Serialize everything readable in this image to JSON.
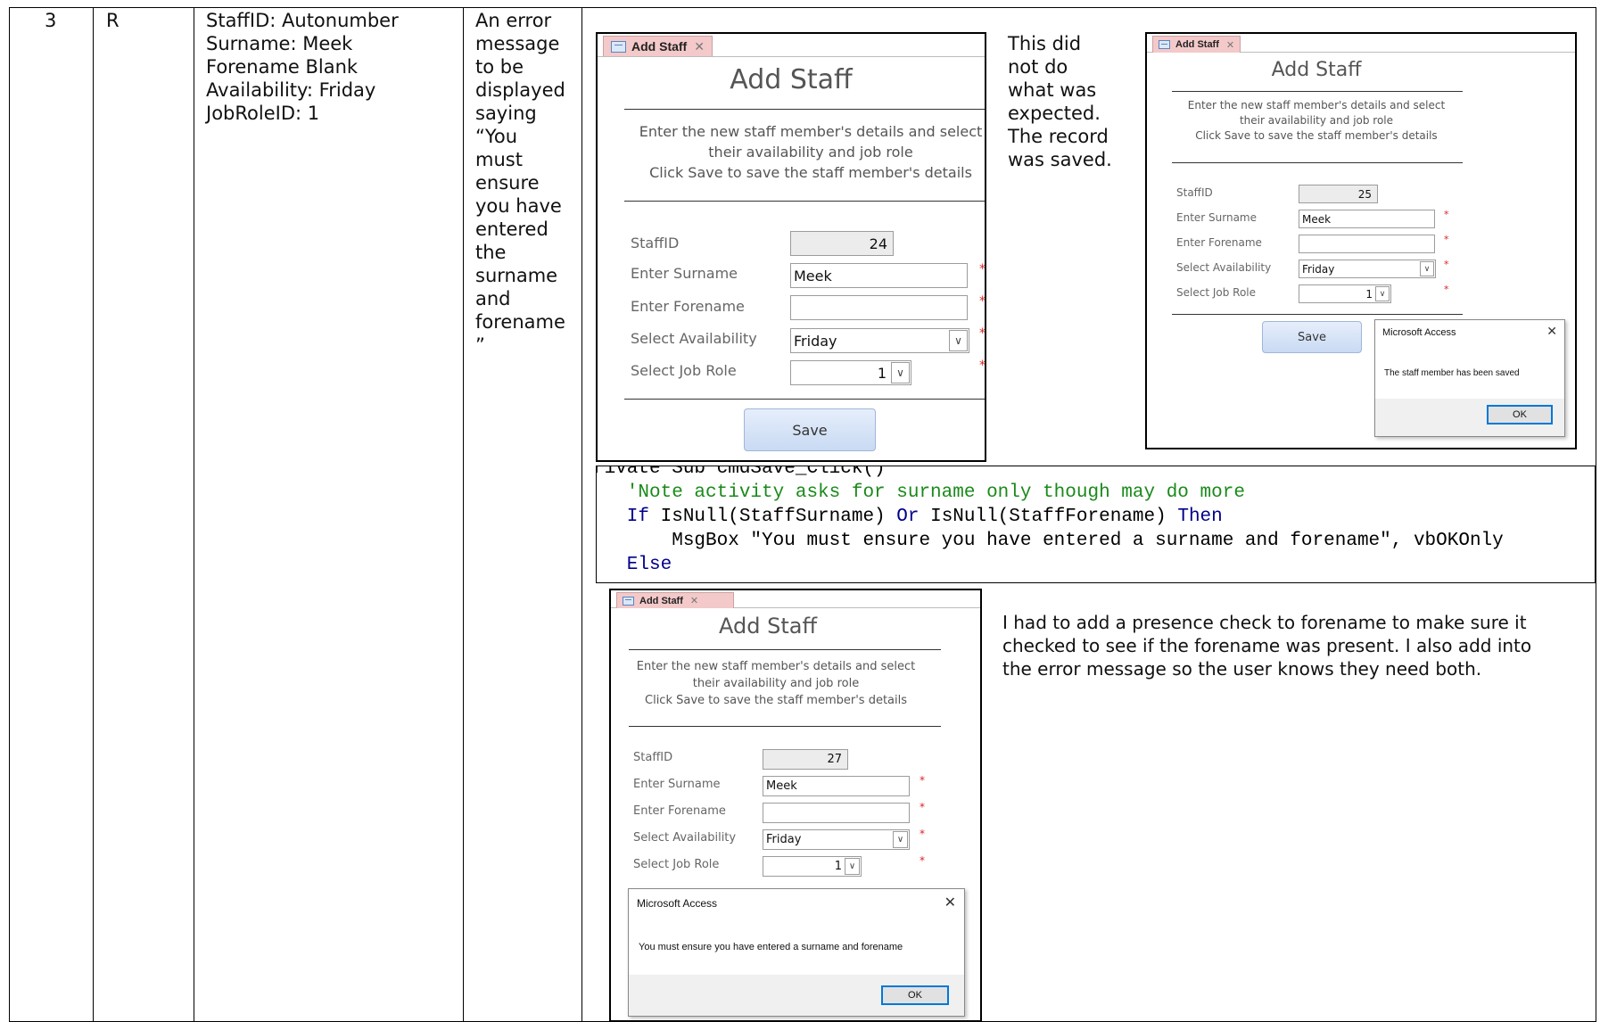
{
  "row": {
    "number": "3",
    "type": "R",
    "test_data": "StaffID: Autonumber\nSurname: Meek\nForename Blank\nAvailability: Friday\nJobRoleID: 1",
    "expected": "An error\nmessage\nto be\ndisplayed\nsaying\n“You\nmust\nensure\nyou have\nentered\nthe\nsurname\nand\nforename\n”",
    "actual_comment": "This did\nnot do\nwhat was\nexpected.\nThe record\nwas saved.",
    "fix_comment": "I had to add a presence check to forename to make sure it\nchecked to see if the forename was present. I also add into\nthe error message so the user knows they need both."
  },
  "form": {
    "tab_label": "Add Staff",
    "title": "Add Staff",
    "instructions": "Enter the new staff member's details and select\ntheir availability and job role\nClick Save to save the staff member's details",
    "labels": {
      "staff_id": "StaffID",
      "surname": "Enter Surname",
      "forename": "Enter Forename",
      "availability": "Select Availability",
      "job_role": "Select Job Role"
    },
    "save_label": "Save",
    "required_marker": "*",
    "combo_arrow": "∨"
  },
  "form1": {
    "staff_id": "24",
    "surname": "Meek",
    "forename": "",
    "availability": "Friday",
    "job_role": "1"
  },
  "form2": {
    "staff_id": "25",
    "surname": "Meek",
    "forename": "",
    "availability": "Friday",
    "job_role": "1"
  },
  "form3": {
    "staff_id": "27",
    "surname": "Meek",
    "forename": "",
    "availability": "Friday",
    "job_role": "1"
  },
  "dialog_saved": {
    "title": "Microsoft Access",
    "message": "The staff member has been saved",
    "ok": "OK",
    "close": "✕"
  },
  "dialog_error": {
    "title": "Microsoft Access",
    "message": "You must ensure you have entered a surname and forename",
    "ok": "OK",
    "close": "✕"
  },
  "code": {
    "lines": [
      "rivate Sub cmdSave_Click()",
      "   'Note activity asks for surname only though may do more",
      "   If IsNull(StaffSurname) Or IsNull(StaffForename) Then",
      "       MsgBox \"You must ensure you have entered a surname and forename\", vbOKOnly",
      "   Else"
    ]
  },
  "colors": {
    "keyword": "#00008b",
    "comment": "#1a8a1a",
    "tab": "#f4c9c9",
    "required": "#e02020",
    "ok_border": "#0078d7"
  }
}
